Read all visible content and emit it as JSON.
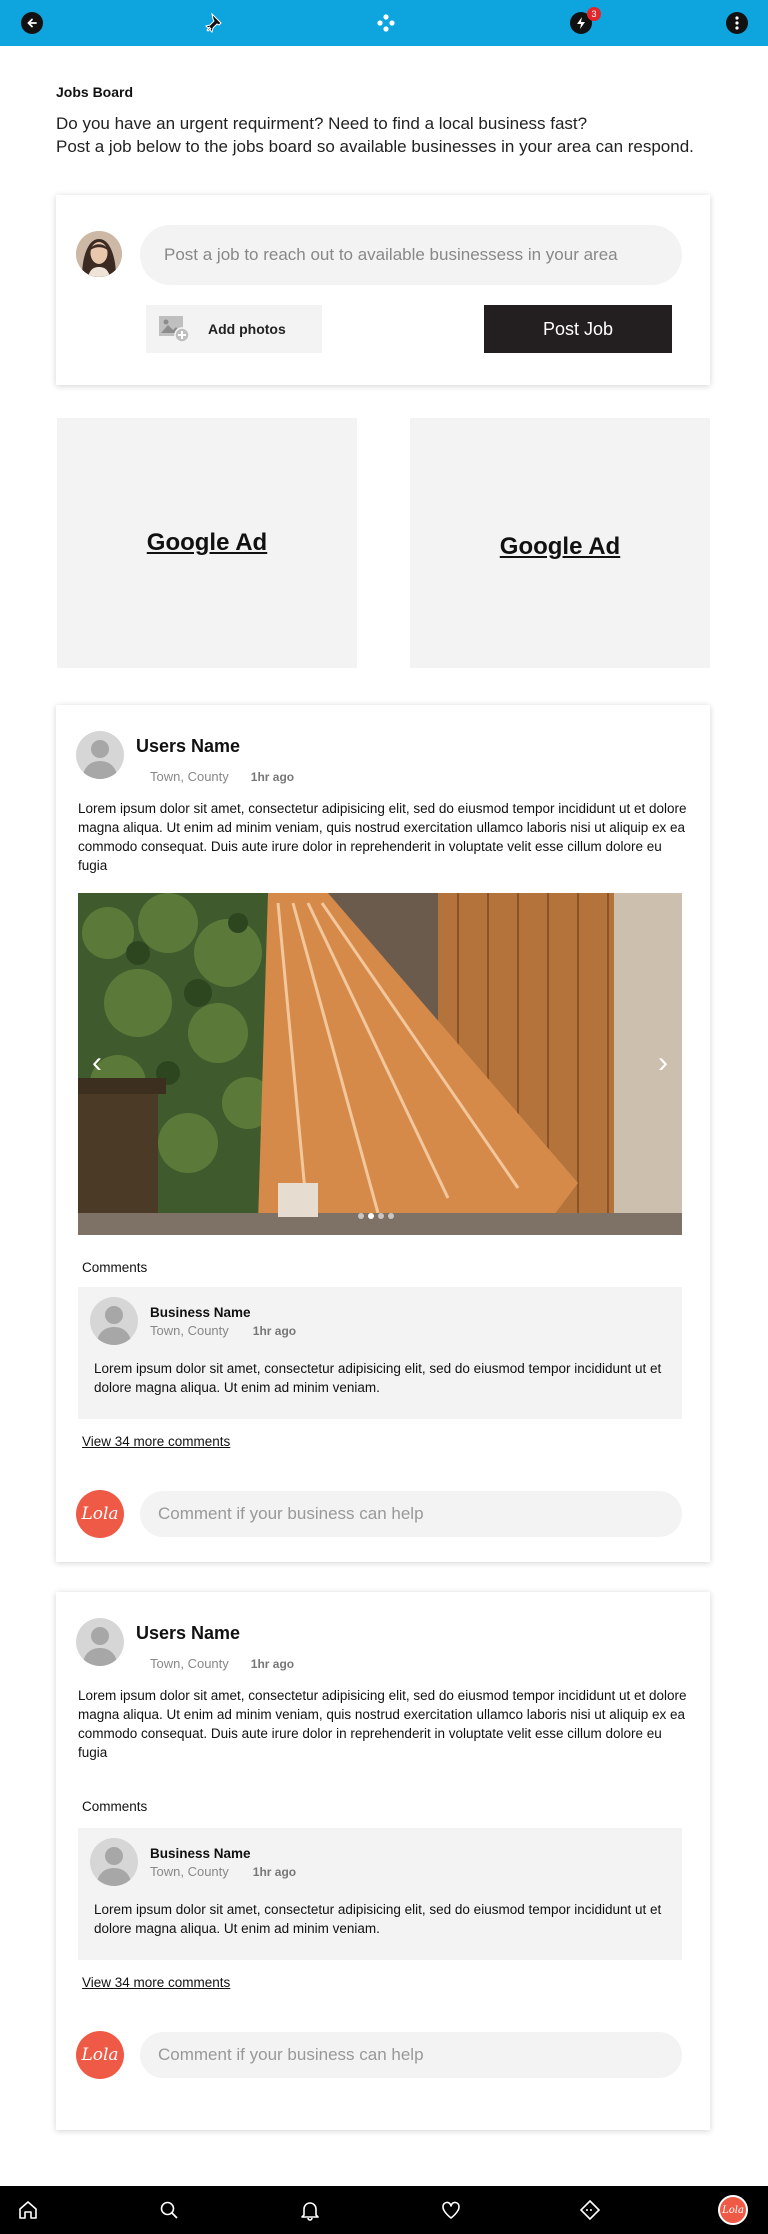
{
  "topbar": {
    "icons": [
      "back-arrow-icon",
      "pin-icon",
      "dots-cluster-icon",
      "lightning-icon",
      "more-vertical-icon"
    ],
    "notification_count": "3",
    "accent": "#0ea4dd"
  },
  "intro": {
    "title": "Jobs Board",
    "line1": "Do you have an urgent requirment? Need to find a local business fast?",
    "line2": "Post a job below to the jobs board so available businesses in your area can respond."
  },
  "post_box": {
    "placeholder": "Post a job to reach out to available businessess in your area",
    "add_photos_label": "Add photos",
    "post_button_label": "Post Job"
  },
  "ads": [
    {
      "label": "Google Ad"
    },
    {
      "label": "Google Ad"
    }
  ],
  "posts": [
    {
      "user_name": "Users Name",
      "location": "Town, County",
      "time": "1hr ago",
      "text": "Lorem ipsum dolor sit amet, consectetur adipisicing elit, sed do eiusmod tempor incididunt ut et dolore magna aliqua. Ut enim ad minim veniam, quis nostrud exercitation ullamco laboris nisi ut aliquip ex ea commodo consequat. Duis aute irure dolor in reprehenderit in voluptate velit esse cillum dolore eu fugia",
      "comments_title": "Comments",
      "comment": {
        "name": "Business Name",
        "location": "Town, County",
        "time": "1hr ago",
        "text": "Lorem ipsum dolor sit amet, consectetur adipisicing elit, sed do eiusmod tempor incididunt ut et dolore magna aliqua. Ut enim ad minim veniam."
      },
      "view_more": "View 34 more comments",
      "comment_placeholder": "Comment if your business can help",
      "lola_label": "Lola"
    },
    {
      "user_name": "Users Name",
      "location": "Town, County",
      "time": "1hr ago",
      "text": "Lorem ipsum dolor sit amet, consectetur adipisicing elit, sed do eiusmod tempor incididunt ut et dolore magna aliqua. Ut enim ad minim veniam, quis nostrud exercitation ullamco laboris nisi ut aliquip ex ea commodo consequat. Duis aute irure dolor in reprehenderit in voluptate velit esse cillum dolore eu fugia",
      "comments_title": "Comments",
      "comment": {
        "name": "Business Name",
        "location": "Town, County",
        "time": "1hr ago",
        "text": "Lorem ipsum dolor sit amet, consectetur adipisicing elit, sed do eiusmod tempor incididunt ut et dolore magna aliqua. Ut enim ad minim veniam."
      },
      "view_more": "View 34 more comments",
      "comment_placeholder": "Comment if your business can help",
      "lola_label": "Lola"
    }
  ],
  "bottombar": {
    "icons": [
      "home-icon",
      "search-icon",
      "bell-icon",
      "heart-icon",
      "ticket-icon",
      "profile-avatar"
    ],
    "profile_label": "Lola"
  }
}
